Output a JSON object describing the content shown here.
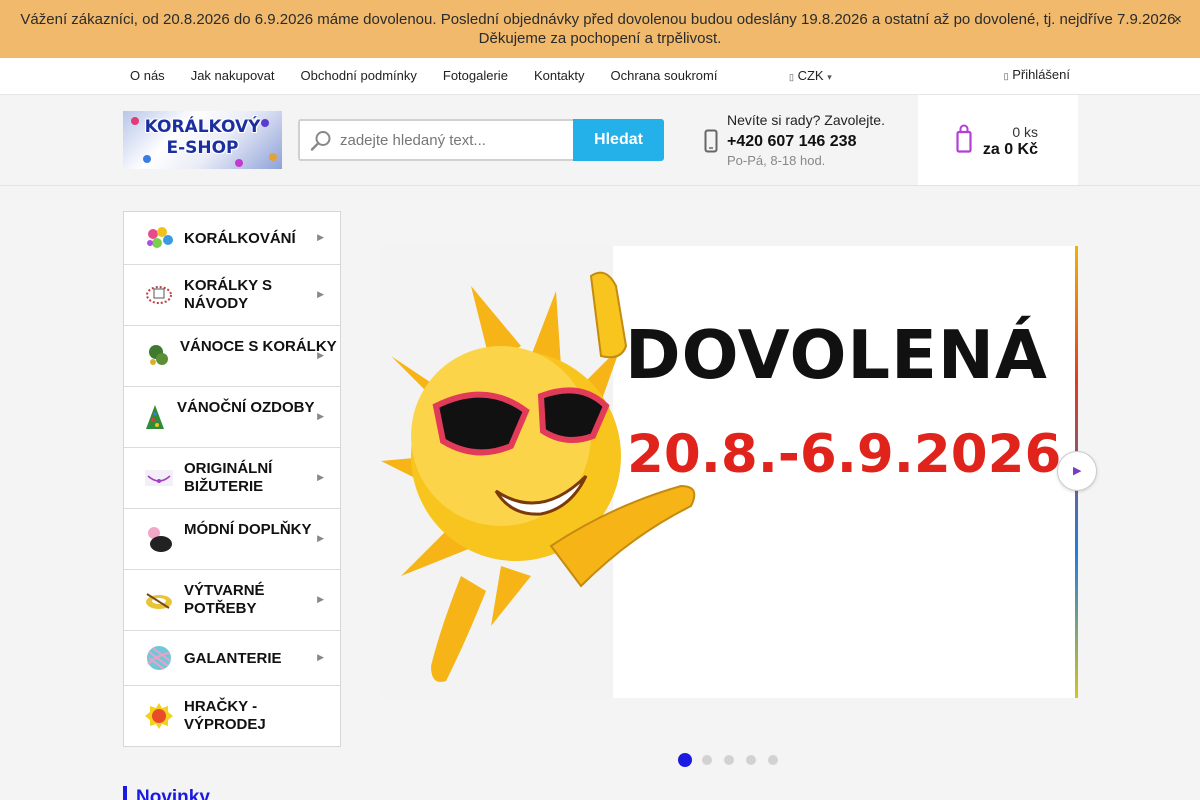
{
  "notice": {
    "line1": "Vážení zákazníci, od 20.8.2026 do 6.9.2026 máme dovolenou. Poslední objednávky před dovolenou budou odeslány 19.8.2026 a ostatní až po dovolené, tj. nejdříve 7.9.2026.",
    "line2": "Děkujeme za pochopení a trpělivost."
  },
  "topnav": {
    "links": [
      "O nás",
      "Jak nakupovat",
      "Obchodní podmínky",
      "Fotogalerie",
      "Kontakty",
      "Ochrana soukromí"
    ],
    "currency": "CZK",
    "login": "Přihlášení"
  },
  "header": {
    "logo": {
      "line1": "KORÁLKOVÝ",
      "line2": "E-SHOP"
    },
    "search": {
      "placeholder": "zadejte hledaný text...",
      "button": "Hledat"
    },
    "help": {
      "question": "Nevíte si rady? Zavolejte.",
      "phone": "+420 607 146 238",
      "hours": "Po-Pá, 8-18 hod."
    },
    "cart": {
      "count": "0 ks",
      "price": "za 0 Kč"
    }
  },
  "categories": [
    {
      "label": "Korálkování"
    },
    {
      "label": "Korálky s návody"
    },
    {
      "label": "Vánoce s korálky"
    },
    {
      "label": "Vánoční ozdoby"
    },
    {
      "label": "Originální bižuterie"
    },
    {
      "label": "Módní doplňky"
    },
    {
      "label": "Výtvarné potřeby"
    },
    {
      "label": "Galanterie"
    },
    {
      "label": "Hračky - výprodej"
    }
  ],
  "banner": {
    "title": "DOVOLENÁ",
    "dates": "20.8.-6.9.2026"
  },
  "slider": {
    "slides": 5,
    "active": 1
  },
  "sections": {
    "new": "Novinky"
  },
  "colors": {
    "notice_bg": "#f0b96c",
    "search_button": "#24b1ea",
    "accent_blue": "#1a1ae0",
    "cart_icon": "#b23fd6",
    "date_red": "#e0241b"
  }
}
